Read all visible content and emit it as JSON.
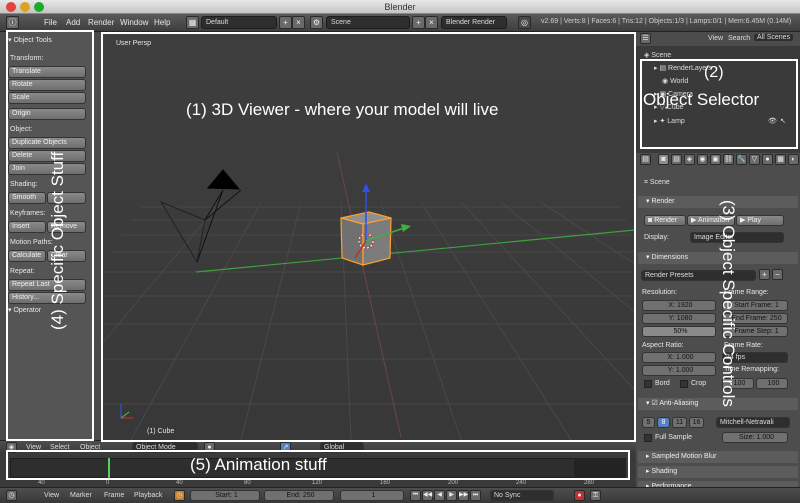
{
  "window": {
    "title": "Blender"
  },
  "menubar": {
    "items": [
      "File",
      "Add",
      "Render",
      "Window",
      "Help"
    ],
    "layout": "Default",
    "scene": "Scene",
    "engine": "Blender Render",
    "stats": "v2.69 | Verts:8 | Faces:6 | Tris:12 | Objects:1/3 | Lamps:0/1 | Mem:6.45M (0.14M)"
  },
  "toolshelf": {
    "header": "Object Tools",
    "transform_label": "Transform:",
    "translate": "Translate",
    "rotate": "Rotate",
    "scale": "Scale",
    "origin": "Origin",
    "object_label": "Object:",
    "duplicate": "Duplicate Objects",
    "delete": "Delete",
    "join": "Join",
    "shading_label": "Shading:",
    "smooth": "Smooth",
    "keyframes_label": "Keyframes:",
    "insert": "Insert",
    "remove": "Remove",
    "motion_label": "Motion Paths:",
    "calculate": "Calculate",
    "clear": "Clear",
    "repeat_label": "Repeat:",
    "repeat_last": "Repeat Last",
    "history": "History...",
    "operator": "Operator"
  },
  "viewport": {
    "view_name": "User Persp",
    "object_name": "(1) Cube"
  },
  "outliner": {
    "tab_view": "View",
    "tab_search": "Search",
    "tab_all": "All Scenes",
    "items": [
      "Scene",
      "RenderLayers",
      "World",
      "Camera",
      "Cube",
      "Lamp"
    ]
  },
  "properties": {
    "scene": "Scene",
    "render_panel": "Render",
    "render_btn": "Render",
    "animation_btn": "Animation",
    "play_btn": "Play",
    "display_label": "Display:",
    "display_value": "Image Editor",
    "dimensions_panel": "Dimensions",
    "render_presets": "Render Presets",
    "resolution_label": "Resolution:",
    "res_x": "X: 1920",
    "res_y": "Y: 1080",
    "res_pct": "50%",
    "frame_range_label": "Frame Range:",
    "start_frame": "Start Frame: 1",
    "end_frame": "End Frame: 250",
    "frame_step": "Frame Step: 1",
    "aspect_label": "Aspect Ratio:",
    "asp_x": "X: 1.000",
    "asp_y": "Y: 1.000",
    "frame_rate_label": "Frame Rate:",
    "fps": "24 fps",
    "remap_label": "Time Remapping:",
    "bord": "Bord",
    "crop": "Crop",
    "old": "100",
    "new": "100",
    "aa_panel": "Anti-Aliasing",
    "aa_5": "5",
    "aa_8": "8",
    "aa_11": "11",
    "aa_16": "16",
    "aa_filter": "Mitchell-Netravali",
    "full_sample": "Full Sample",
    "size": "Size: 1.000",
    "motion_blur": "Sampled Motion Blur",
    "shading_panel": "Shading",
    "performance_panel": "Performance"
  },
  "view3d_header": {
    "view": "View",
    "select": "Select",
    "object": "Object",
    "mode": "Object Mode",
    "orientation": "Global"
  },
  "timeline_header": {
    "view": "View",
    "marker": "Marker",
    "frame": "Frame",
    "playback": "Playback",
    "start": "Start: 1",
    "end": "End: 250",
    "current": "1",
    "sync": "No Sync"
  },
  "timeline_ticks": [
    "40",
    "0",
    "40",
    "80",
    "120",
    "160",
    "200",
    "240",
    "280"
  ],
  "annotations": {
    "a1": "(1) 3D Viewer - where your model will live",
    "a2_num": "(2)",
    "a2_text": "Object Selector",
    "a3": "(3) Object Specific Controls",
    "a4": "(4) Specific Object Stuff",
    "a5": "(5) Animation stuff"
  },
  "colors": {
    "annotation": "#ffffff",
    "selection_orange": "#ffa030",
    "axis_red": "#c03030",
    "axis_green": "#40b040",
    "axis_blue": "#3050e0"
  }
}
